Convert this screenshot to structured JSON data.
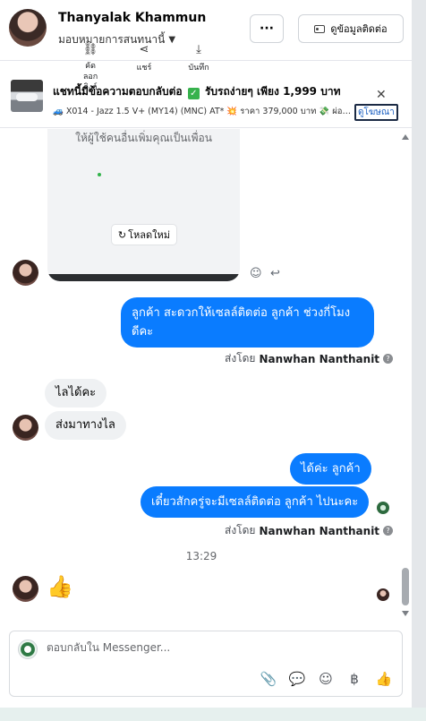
{
  "header": {
    "contact_name": "Thanyalak Khammun",
    "assign_label": "มอบหมายการสนทนานี้",
    "more_label": "···",
    "contact_info_label": "ดูข้อมูลติดต่อ"
  },
  "ad": {
    "title_part1": "แชทนี้มีข้อความตอบกลับต่อ",
    "title_part2": "รับรถง่ายๆ เพียง 1,999 บาท",
    "check_glyph": "✓",
    "subtitle": "🚙 X014 - Jazz 1.5 V+ (MY14) (MNC) AT* 💥 ราคา 379,000 บาท 💸 ผ่อน...",
    "link_label": "ดูโฆษณา",
    "close_label": "✕"
  },
  "shared_card": {
    "text": "ให้ผู้ใช้คนอื่นเพิ่มคุณเป็นเพื่อน",
    "copy_label": "คัด ลอก ลิงก์",
    "share_label": "แชร์",
    "save_label": "บันทึก",
    "reload_label": "โหลดใหม่",
    "reload_glyph": "↻"
  },
  "messages": {
    "out1": "ลูกค้า สะดวกให้เซลล์ติดต่อ ลูกค้า ช่วงกี่โมง ดีคะ",
    "sent_by_prefix": "ส่งโดย",
    "sent_by_name": "Nanwhan Nanthanit",
    "in1": "ไลได้คะ",
    "in2": "ส่งมาทางไล",
    "out2": "ได้ค่ะ  ลูกค้า",
    "out3": "เดี๋ยวสักครู่จะมีเซลล์ติดต่อ ลูกค้า ไปนะคะ",
    "timestamp": "13:29",
    "like_emoji": "👍"
  },
  "composer": {
    "placeholder": "ตอบกลับใน Messenger..."
  },
  "icons": {
    "info": "?",
    "smile": "☺",
    "reply": "↩",
    "attach": "📎",
    "saved_replies": "💬",
    "emoji": "☺",
    "currency": "฿",
    "like": "👍"
  },
  "colors": {
    "brand_blue": "#0a7cff",
    "incoming_bubble": "#eff1f3"
  }
}
